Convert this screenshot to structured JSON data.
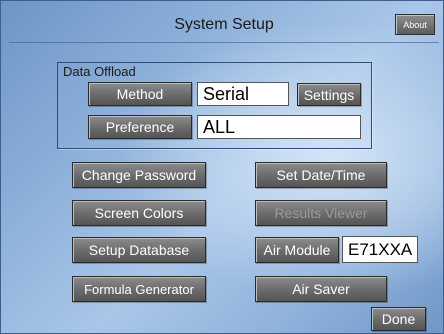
{
  "header": {
    "title": "System Setup",
    "about_label": "About"
  },
  "data_offload": {
    "label": "Data Offload",
    "method_label": "Method",
    "method_value": "Serial",
    "settings_label": "Settings",
    "preference_label": "Preference",
    "preference_value": "ALL"
  },
  "actions": {
    "change_password": "Change Password",
    "set_date_time": "Set Date/Time",
    "screen_colors": "Screen Colors",
    "results_viewer": "Results Viewer",
    "setup_database": "Setup Database",
    "air_module_label": "Air Module",
    "air_module_value": "E71XXA",
    "formula_generator": "Formula Generator",
    "air_saver": "Air Saver",
    "done": "Done"
  },
  "colors": {
    "background": "#8eb1da",
    "button": "#6a6a6a",
    "button_text": "#ffffff",
    "disabled_text": "#9a9a9a"
  }
}
